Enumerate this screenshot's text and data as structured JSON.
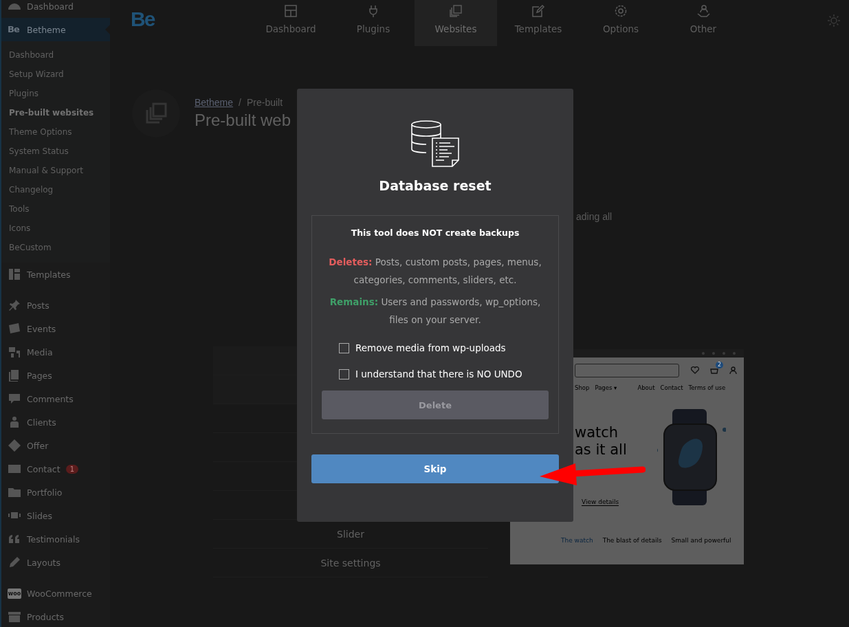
{
  "sidebar": {
    "groups": [
      {
        "items": [
          {
            "label": "Dashboard",
            "selected": false
          },
          {
            "label": "Betheme",
            "icon_text": "Be",
            "selected": true,
            "children": [
              {
                "label": "Dashboard",
                "selected": false
              },
              {
                "label": "Setup Wizard",
                "selected": false
              },
              {
                "label": "Plugins",
                "selected": false
              },
              {
                "label": "Pre-built websites",
                "selected": true
              },
              {
                "label": "Theme Options",
                "selected": false
              },
              {
                "label": "System Status",
                "selected": false
              },
              {
                "label": "Manual & Support",
                "selected": false
              },
              {
                "label": "Changelog",
                "selected": false
              },
              {
                "label": "Tools",
                "selected": false
              },
              {
                "label": "Icons",
                "selected": false
              },
              {
                "label": "BeCustom",
                "selected": false
              }
            ]
          },
          {
            "label": "Templates",
            "selected": false
          }
        ]
      },
      {
        "items": [
          {
            "label": "Posts",
            "selected": false
          },
          {
            "label": "Events",
            "selected": false
          },
          {
            "label": "Media",
            "selected": false
          },
          {
            "label": "Pages",
            "selected": false
          },
          {
            "label": "Comments",
            "selected": false
          },
          {
            "label": "Clients",
            "selected": false
          },
          {
            "label": "Offer",
            "selected": false
          },
          {
            "label": "Contact",
            "badge": "1",
            "selected": false
          },
          {
            "label": "Portfolio",
            "selected": false
          },
          {
            "label": "Slides",
            "selected": false
          },
          {
            "label": "Testimonials",
            "selected": false
          },
          {
            "label": "Layouts",
            "selected": false
          }
        ]
      },
      {
        "items": [
          {
            "label": "WooCommerce",
            "icon_text": "woo",
            "selected": false
          },
          {
            "label": "Products",
            "selected": false
          }
        ]
      }
    ]
  },
  "topbar": {
    "logo": "Be",
    "tabs": [
      {
        "label": "Dashboard",
        "selected": false
      },
      {
        "label": "Plugins",
        "selected": false
      },
      {
        "label": "Websites",
        "selected": true
      },
      {
        "label": "Templates",
        "selected": false
      },
      {
        "label": "Options",
        "selected": false
      },
      {
        "label": "Other",
        "selected": false
      }
    ]
  },
  "page_header": {
    "breadcrumb": [
      "Betheme",
      "/",
      "Pre-built"
    ],
    "title": "Pre-built web"
  },
  "description_fragment": "ading all",
  "list": {
    "items": [
      "Slider",
      "Site settings"
    ]
  },
  "preview": {
    "nav": [
      "Shop",
      "Pages ▾",
      "About",
      "Contact",
      "Terms of use"
    ],
    "cart_badge": "2",
    "hero_lines": [
      "watch",
      "as it all"
    ],
    "link": "View details",
    "tabs": [
      "The watch",
      "The blast of details",
      "Small and powerful"
    ]
  },
  "modal": {
    "title": "Database reset",
    "warning": "This tool does NOT create backups",
    "paragraphs": [
      {
        "kind": "deletes",
        "text": "**Deletes:** Posts, custom posts, pages, menus, categories, comments, sliders, etc."
      },
      {
        "kind": "remains",
        "text": "**Remains:** Users and passwords, wp_options, files on your server."
      }
    ],
    "checkboxes": [
      {
        "label": "Remove media from wp-uploads",
        "checked": false
      },
      {
        "label": "I understand that there is NO UNDO",
        "checked": false
      }
    ],
    "delete_button": {
      "label": "Delete",
      "disabled": true
    },
    "skip_button": {
      "label": "Skip"
    }
  },
  "annotation": {
    "kind": "arrow"
  }
}
